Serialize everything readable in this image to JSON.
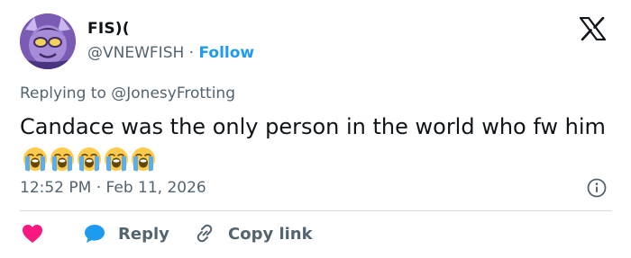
{
  "tweet": {
    "author": {
      "display_name": "FIS)(",
      "handle": "@VNEWFISH",
      "separator": " · ",
      "follow_label": "Follow"
    },
    "brand_icon": "x-logo-icon",
    "replying_to_prefix": "Replying to ",
    "replying_to_handle": "@JonesyFrotting",
    "text": "Candace was the only person in the world who fw him",
    "emojis": [
      "loudly-crying-face",
      "loudly-crying-face",
      "loudly-crying-face",
      "loudly-crying-face",
      "loudly-crying-face"
    ],
    "timestamp": "12:52 PM · Feb 11, 2026",
    "actions": {
      "like_icon": "heart-icon",
      "reply_label": "Reply",
      "copy_label": "Copy link"
    }
  },
  "colors": {
    "link": "#1d9bf0",
    "muted": "#536471",
    "heart": "#f91880",
    "reply_bubble": "#1d9bf0",
    "divider": "#cfd9de"
  }
}
